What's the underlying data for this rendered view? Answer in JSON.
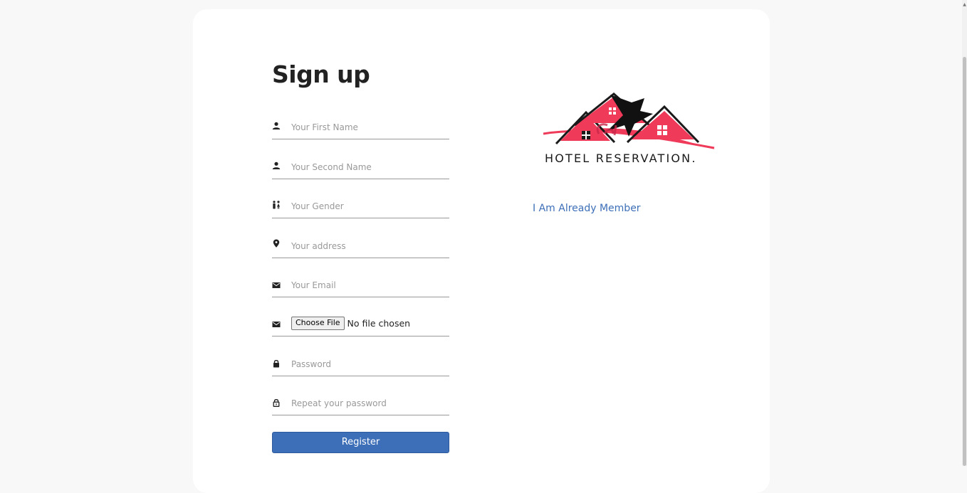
{
  "form": {
    "title": "Sign up",
    "fields": [
      {
        "icon": "person-icon",
        "placeholder": "Your First Name"
      },
      {
        "icon": "person-icon",
        "placeholder": "Your Second Name"
      },
      {
        "icon": "gender-icon",
        "placeholder": "Your Gender"
      },
      {
        "icon": "map-pin-icon",
        "placeholder": "Your address"
      },
      {
        "icon": "envelope-icon",
        "placeholder": "Your Email"
      },
      {
        "icon": "envelope-icon",
        "file_button": "Choose File",
        "file_status": "No file chosen"
      },
      {
        "icon": "lock-icon",
        "placeholder": "Password"
      },
      {
        "icon": "lock-open-icon",
        "placeholder": "Repeat your password"
      }
    ],
    "register_label": "Register"
  },
  "side": {
    "logo_text": "HOTEL RESERVATION.",
    "logo_colors": {
      "red": "#f03a5a",
      "dark": "#1a1a1a"
    },
    "member_link": "I Am Already Member"
  },
  "colors": {
    "accent": "#3d6fb8",
    "background": "#f8f8f8",
    "card": "#ffffff"
  }
}
